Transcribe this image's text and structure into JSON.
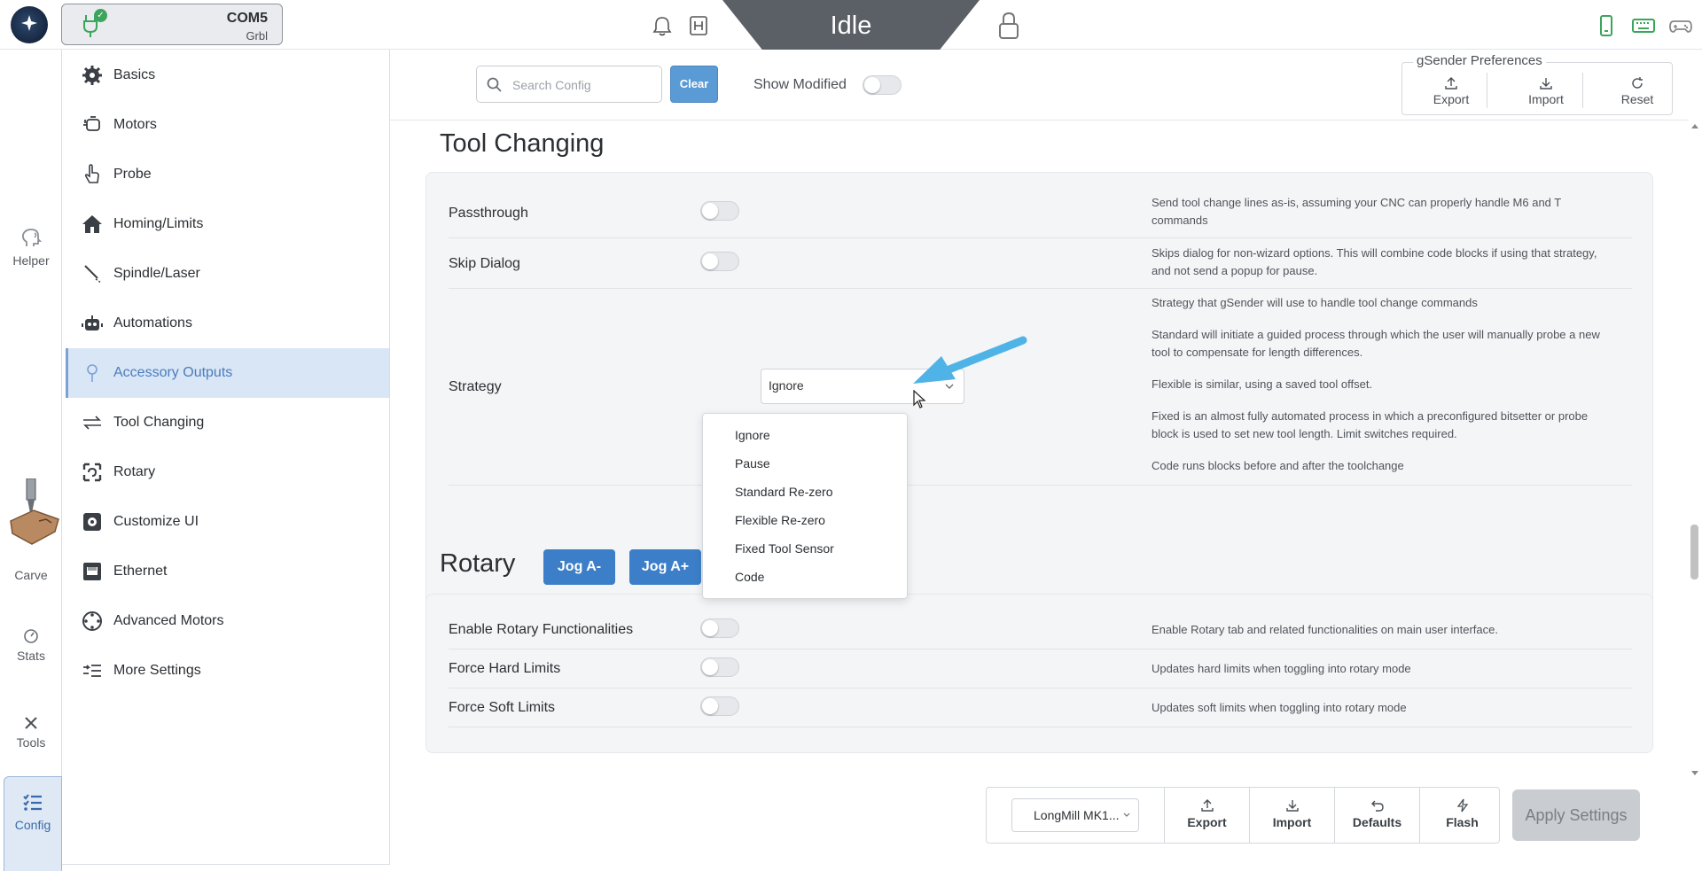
{
  "header": {
    "connection": {
      "port": "COM5",
      "firmware": "Grbl"
    },
    "machine_state": "Idle"
  },
  "rail": {
    "items": [
      {
        "label": "Helper",
        "icon": "helper-icon"
      },
      {
        "label": "Carve",
        "icon": "carve-icon"
      },
      {
        "label": "Stats",
        "icon": "stats-icon"
      },
      {
        "label": "Tools",
        "icon": "tools-icon"
      },
      {
        "label": "Config",
        "icon": "config-icon"
      }
    ],
    "active": "Config"
  },
  "nav": {
    "items": [
      {
        "label": "Basics",
        "icon": "gear-icon"
      },
      {
        "label": "Motors",
        "icon": "motor-icon"
      },
      {
        "label": "Probe",
        "icon": "probe-hand-icon"
      },
      {
        "label": "Homing/Limits",
        "icon": "home-icon"
      },
      {
        "label": "Spindle/Laser",
        "icon": "spindle-icon"
      },
      {
        "label": "Automations",
        "icon": "robot-icon"
      },
      {
        "label": "Accessory Outputs",
        "icon": "pin-icon"
      },
      {
        "label": "Tool Changing",
        "icon": "swap-arrows-icon"
      },
      {
        "label": "Rotary",
        "icon": "rotary-icon"
      },
      {
        "label": "Customize UI",
        "icon": "customize-icon"
      },
      {
        "label": "Ethernet",
        "icon": "ethernet-icon"
      },
      {
        "label": "Advanced Motors",
        "icon": "advanced-motors-icon"
      },
      {
        "label": "More Settings",
        "icon": "list-arrow-icon"
      }
    ],
    "active": "Accessory Outputs"
  },
  "toolbar": {
    "search_placeholder": "Search Config",
    "search_value": "",
    "clear_label": "Clear",
    "show_modified_label": "Show Modified",
    "show_modified_on": false,
    "prefs": {
      "title": "gSender Preferences",
      "export_label": "Export",
      "import_label": "Import",
      "reset_label": "Reset"
    }
  },
  "tool_changing": {
    "title": "Tool Changing",
    "rows": [
      {
        "label": "Passthrough",
        "enabled": false,
        "desc": "Send tool change lines as-is, assuming your CNC can properly handle M6 and T commands"
      },
      {
        "label": "Skip Dialog",
        "enabled": false,
        "desc": "Skips dialog for non-wizard options. This will combine code blocks if using that strategy, and not send a popup for pause."
      }
    ],
    "strategy": {
      "label": "Strategy",
      "value": "Ignore",
      "options": [
        "Ignore",
        "Pause",
        "Standard Re-zero",
        "Flexible Re-zero",
        "Fixed Tool Sensor",
        "Code"
      ],
      "desc": [
        "Strategy that gSender will use to handle tool change commands",
        "Standard will initiate a guided process through which the user will manually probe a new tool to compensate for length differences.",
        "Flexible is similar, using a saved tool offset.",
        "Fixed is an almost fully automated process in which a preconfigured bitsetter or probe block is used to set new tool length. Limit switches required.",
        "Code runs blocks before and after the toolchange"
      ]
    }
  },
  "rotary": {
    "title": "Rotary",
    "jog_minus_label": "Jog A-",
    "jog_plus_label": "Jog A+",
    "rows": [
      {
        "label": "Enable Rotary Functionalities",
        "enabled": false,
        "desc": "Enable Rotary tab and related functionalities on main user interface."
      },
      {
        "label": "Force Hard Limits",
        "enabled": false,
        "desc": "Updates hard limits when toggling into rotary mode"
      },
      {
        "label": "Force Soft Limits",
        "enabled": false,
        "desc": "Updates soft limits when toggling into rotary mode"
      }
    ]
  },
  "bottom": {
    "machine_profile": "LongMill MK1...",
    "export_label": "Export",
    "import_label": "Import",
    "defaults_label": "Defaults",
    "flash_label": "Flash",
    "apply_label": "Apply Settings"
  },
  "colors": {
    "accent": "#3c7fc8",
    "active_nav_bg": "#d9e6f5",
    "state_bg": "#5b5f66",
    "annotation_arrow": "#4fb3e8"
  }
}
